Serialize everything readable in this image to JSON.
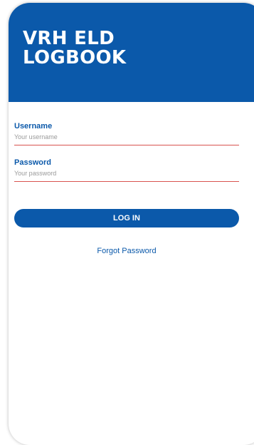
{
  "header": {
    "title_line1": "VRH ELD",
    "title_line2": "LOGBOOK"
  },
  "form": {
    "username": {
      "label": "Username",
      "placeholder": "Your username",
      "value": ""
    },
    "password": {
      "label": "Password",
      "placeholder": "Your password",
      "value": ""
    },
    "login_label": "LOG IN",
    "forgot_label": "Forgot Password"
  },
  "colors": {
    "brand": "#0b59aa",
    "input_underline": "#d9534f"
  }
}
